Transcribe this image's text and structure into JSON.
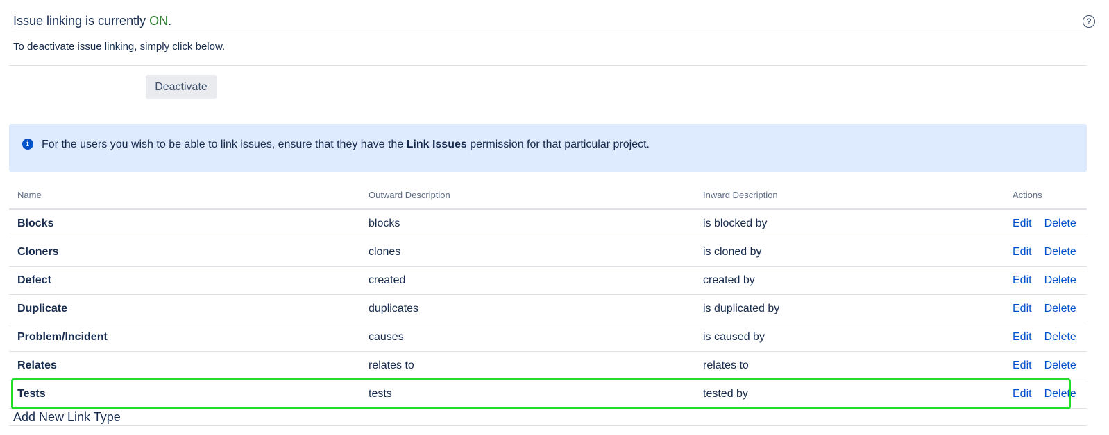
{
  "status": {
    "prefix": "Issue linking is currently ",
    "state": "ON",
    "suffix": "."
  },
  "help_icon": "question-circle-icon",
  "hint": "To deactivate issue linking, simply click below.",
  "deactivate_label": "Deactivate",
  "info": {
    "icon": "info-icon",
    "before": "For the users you wish to be able to link issues, ensure that they have the ",
    "bold": "Link Issues",
    "after": " permission for that particular project."
  },
  "table": {
    "headers": {
      "name": "Name",
      "outward": "Outward Description",
      "inward": "Inward Description",
      "actions": "Actions"
    },
    "rows": [
      {
        "name": "Blocks",
        "outward": "blocks",
        "inward": "is blocked by",
        "edit": "Edit",
        "delete": "Delete"
      },
      {
        "name": "Cloners",
        "outward": "clones",
        "inward": "is cloned by",
        "edit": "Edit",
        "delete": "Delete"
      },
      {
        "name": "Defect",
        "outward": "created",
        "inward": "created by",
        "edit": "Edit",
        "delete": "Delete"
      },
      {
        "name": "Duplicate",
        "outward": "duplicates",
        "inward": "is duplicated by",
        "edit": "Edit",
        "delete": "Delete"
      },
      {
        "name": "Problem/Incident",
        "outward": "causes",
        "inward": "is caused by",
        "edit": "Edit",
        "delete": "Delete"
      },
      {
        "name": "Relates",
        "outward": "relates to",
        "inward": "relates to",
        "edit": "Edit",
        "delete": "Delete"
      },
      {
        "name": "Tests",
        "outward": "tests",
        "inward": "tested by",
        "edit": "Edit",
        "delete": "Delete"
      }
    ]
  },
  "add_title": "Add New Link Type",
  "colors": {
    "on_state": "#2e7d32",
    "link": "#0052cc",
    "info_bg": "#deebff",
    "highlight": "#22e02a"
  }
}
